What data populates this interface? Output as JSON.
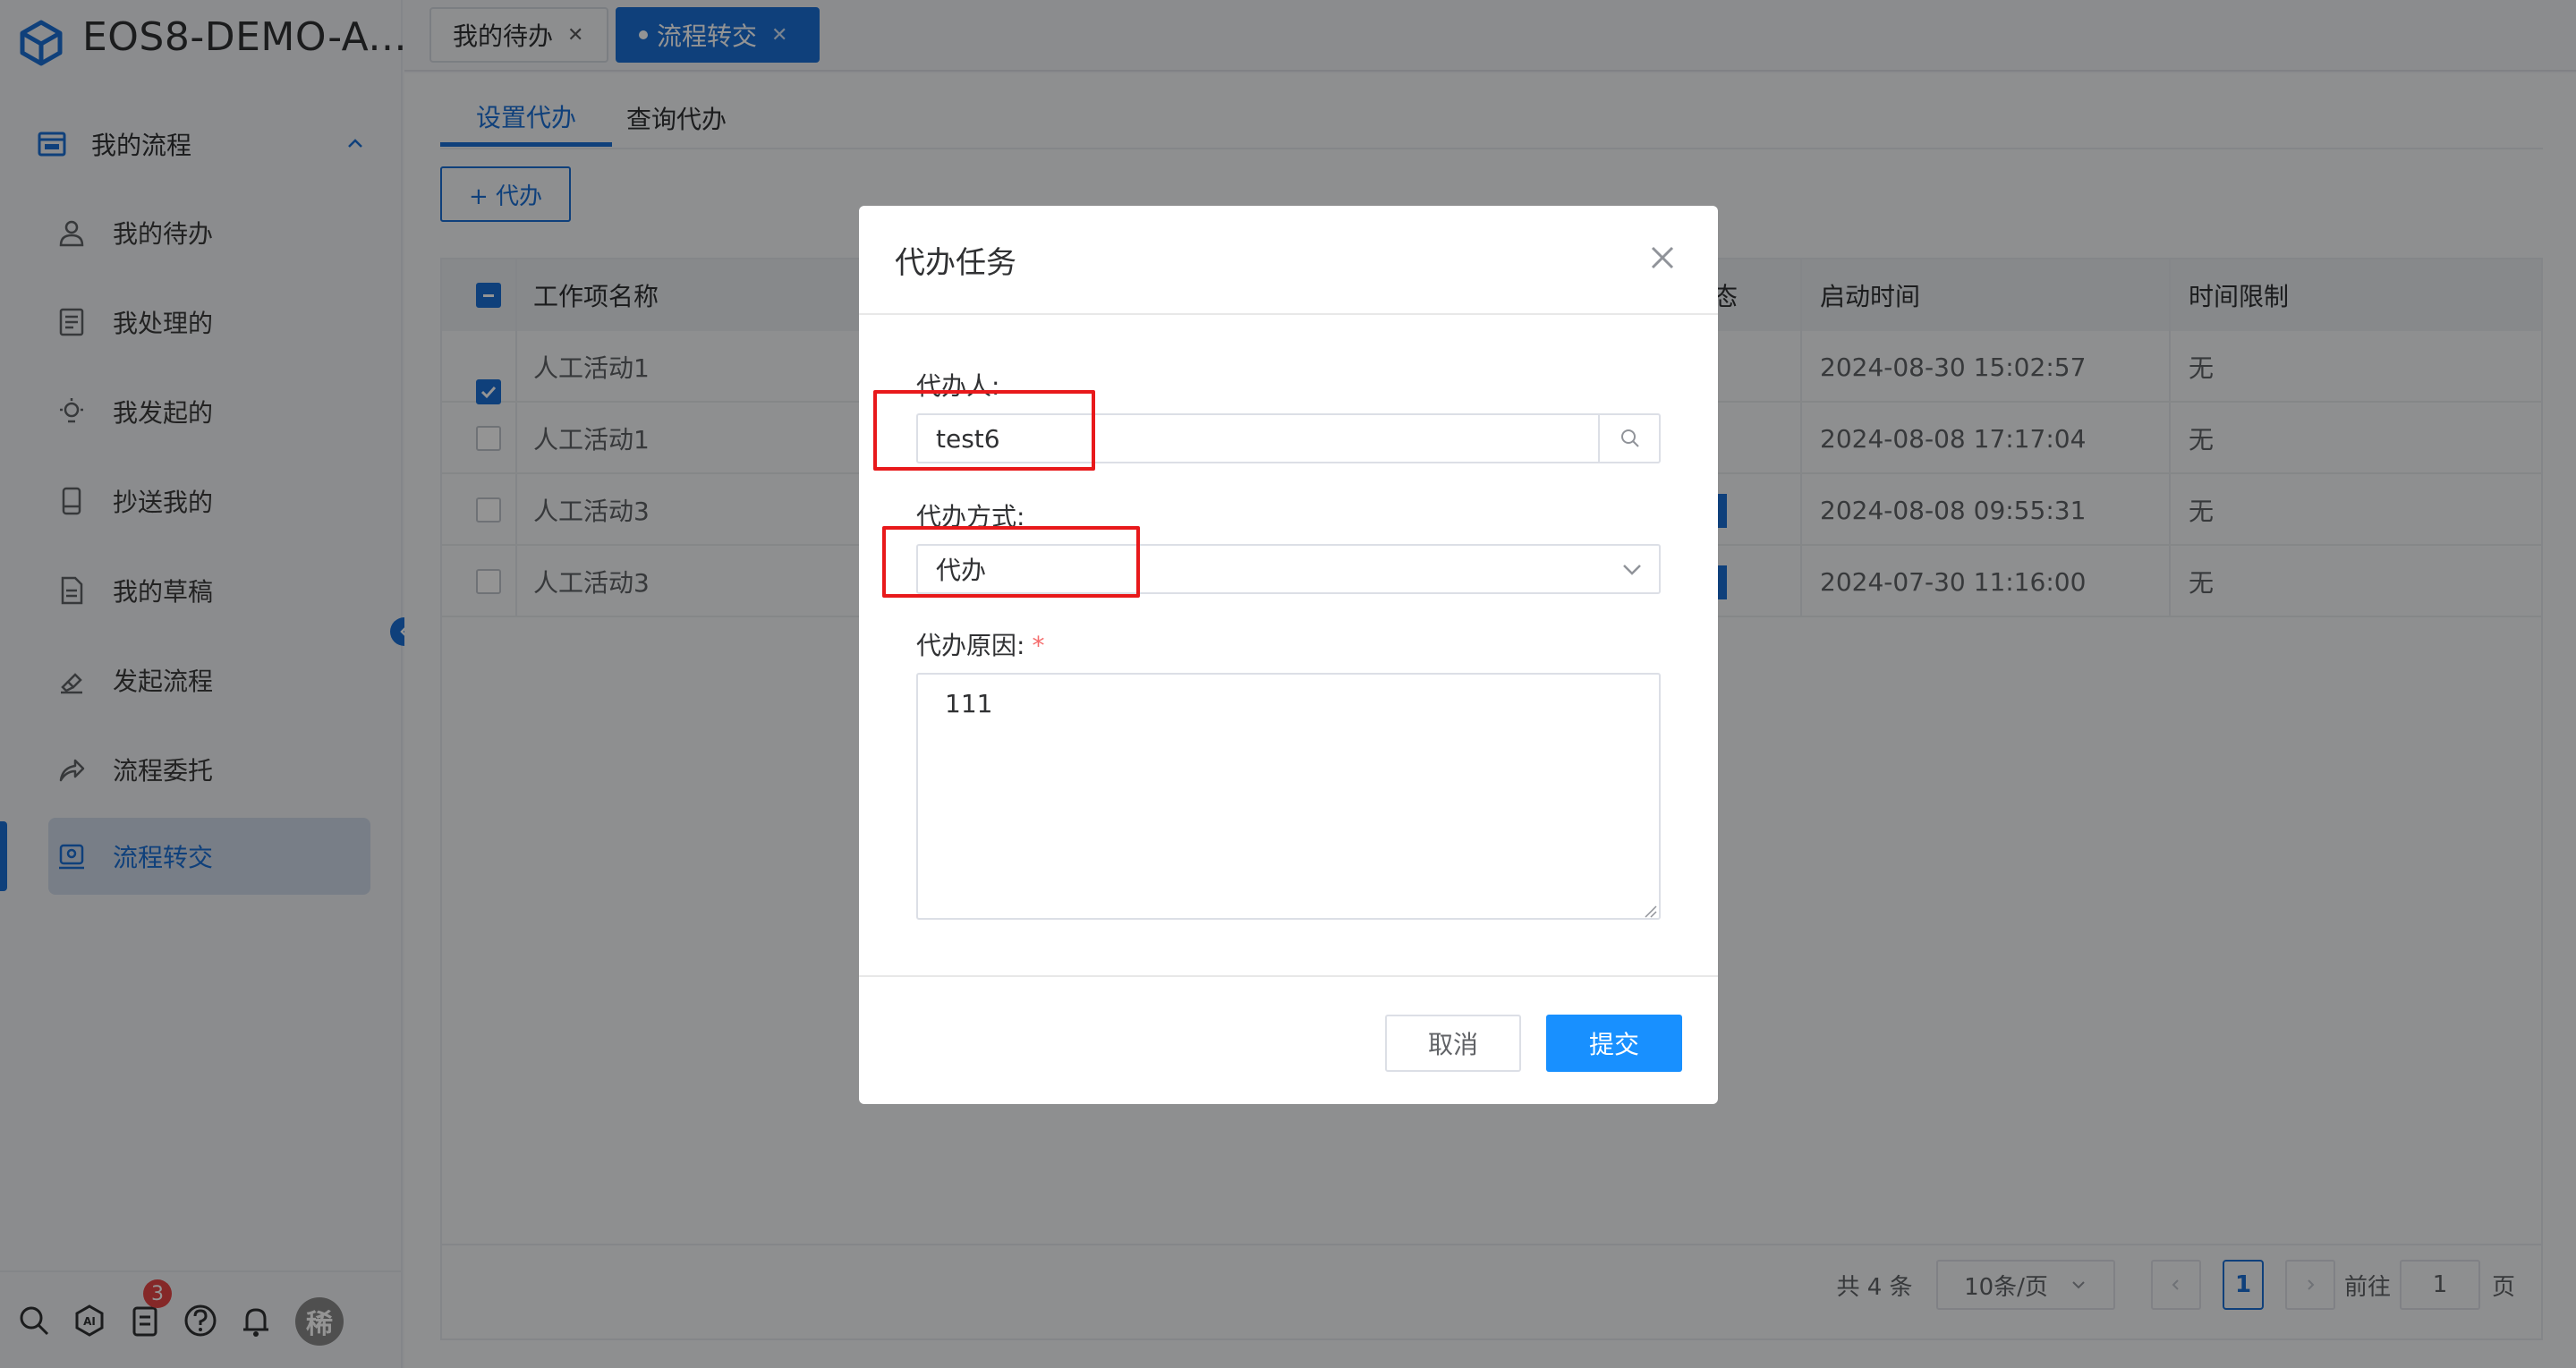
{
  "app": {
    "title": "EOS8-DEMO-A..."
  },
  "sidebar": {
    "group_label": "我的流程",
    "items": [
      {
        "label": "我的待办",
        "icon": "user-icon"
      },
      {
        "label": "我处理的",
        "icon": "document-list-icon"
      },
      {
        "label": "我发起的",
        "icon": "lightbulb-icon"
      },
      {
        "label": "抄送我的",
        "icon": "tablet-icon"
      },
      {
        "label": "我的草稿",
        "icon": "draft-icon"
      },
      {
        "label": "发起流程",
        "icon": "stamp-icon"
      },
      {
        "label": "流程委托",
        "icon": "share-icon"
      },
      {
        "label": "流程转交",
        "icon": "transfer-icon",
        "active": true
      }
    ],
    "bottom": {
      "badge_count": "3",
      "avatar_text": "稀"
    }
  },
  "tabs": [
    {
      "label": "我的待办",
      "active": false
    },
    {
      "label": "流程转交",
      "active": true
    }
  ],
  "subtabs": {
    "set": "设置代办",
    "query": "查询代办"
  },
  "toolbar": {
    "add_label": "+ 代办"
  },
  "table": {
    "headers": {
      "name": "工作项名称",
      "status": "态",
      "start_time": "启动时间",
      "time_limit": "时间限制"
    },
    "rows": [
      {
        "name": "人工活动1",
        "start_time": "2024-08-30 15:02:57",
        "time_limit": "无",
        "checked": true
      },
      {
        "name": "人工活动1",
        "start_time": "2024-08-08 17:17:04",
        "time_limit": "无",
        "checked": false
      },
      {
        "name": "人工活动3",
        "start_time": "2024-08-08 09:55:31",
        "time_limit": "无",
        "checked": false
      },
      {
        "name": "人工活动3",
        "start_time": "2024-07-30 11:16:00",
        "time_limit": "无",
        "checked": false
      }
    ]
  },
  "pagination": {
    "total": "共 4 条",
    "page_size": "10条/页",
    "current": "1",
    "goto_label": "前往",
    "goto_value": "1",
    "page_unit": "页"
  },
  "dialog": {
    "title": "代办任务",
    "agent_label": "代办人:",
    "agent_value": "test6",
    "mode_label": "代办方式:",
    "mode_value": "代办",
    "reason_label": "代办原因:",
    "reason_required": "*",
    "reason_value": "111",
    "cancel_label": "取消",
    "submit_label": "提交"
  },
  "colors": {
    "primary": "#1a6fd4",
    "submit": "#1890ff",
    "annotation": "#e8191b",
    "badge": "#e64545"
  }
}
